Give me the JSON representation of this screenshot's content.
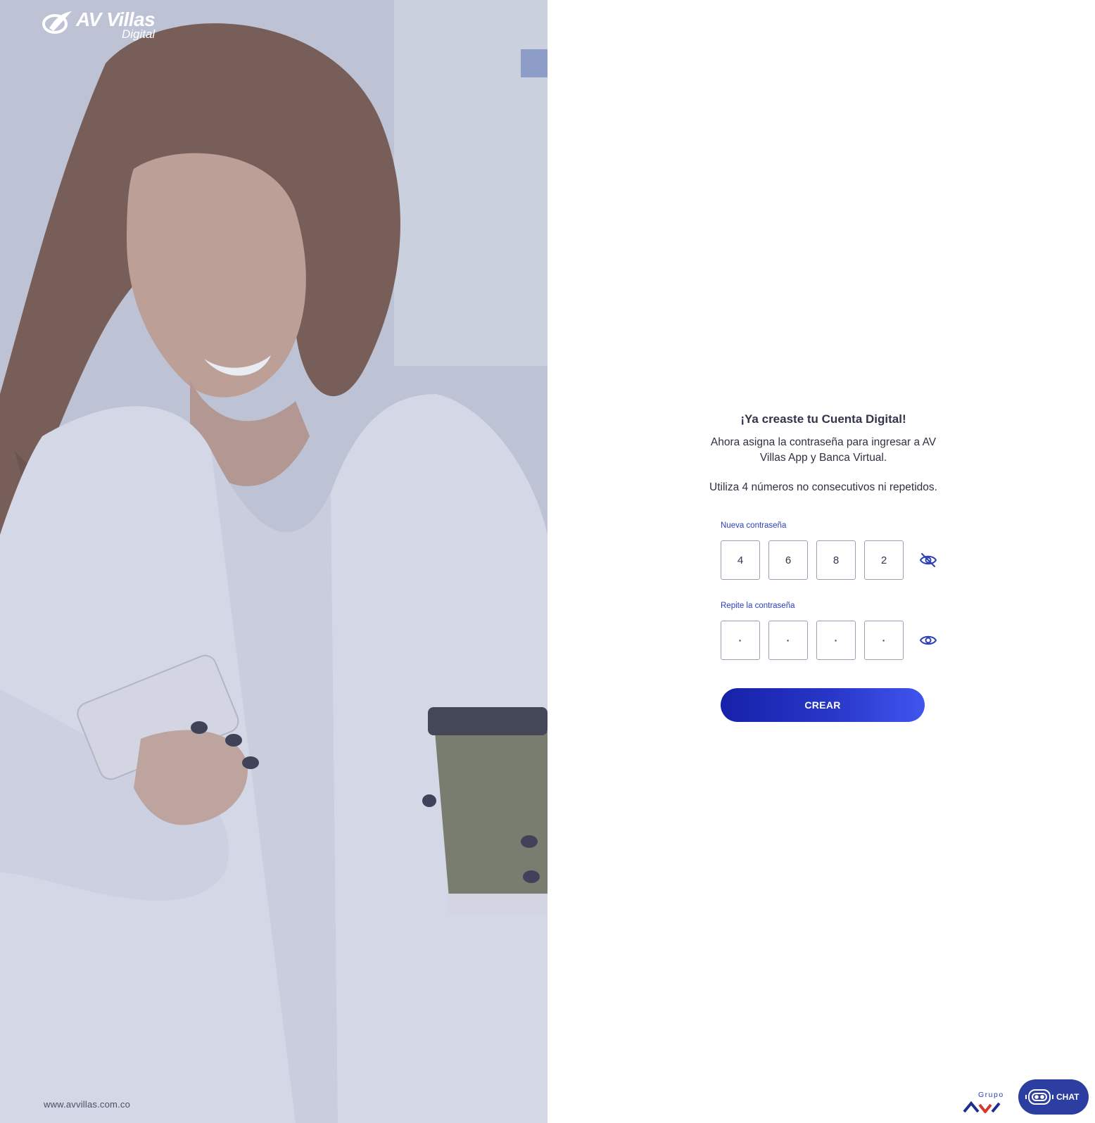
{
  "brand": {
    "name": "AV Villas",
    "sub": "Digital"
  },
  "hero": {
    "website": "www.avvillas.com.co"
  },
  "form": {
    "title": "¡Ya creaste tu Cuenta Digital!",
    "lead": "Ahora asigna la contraseña para ingresar a AV Villas App y Banca Virtual.",
    "rule": "Utiliza 4 números no consecutivos ni repetidos.",
    "new_password": {
      "label": "Nueva contraseña",
      "digits": [
        "4",
        "6",
        "8",
        "2"
      ],
      "toggle_icon": "eye-off-icon"
    },
    "repeat_password": {
      "label": "Repite la contraseña",
      "digits": [
        "·",
        "·",
        "·",
        "·"
      ],
      "toggle_icon": "eye-icon"
    },
    "submit_label": "CREAR"
  },
  "footer": {
    "group_text": "Grupo",
    "chat_label": "CHAT"
  },
  "colors": {
    "primary": "#2b40b8",
    "button_start": "#1521a8",
    "button_end": "#4055ef",
    "chat_bg": "#2c3e9f"
  }
}
